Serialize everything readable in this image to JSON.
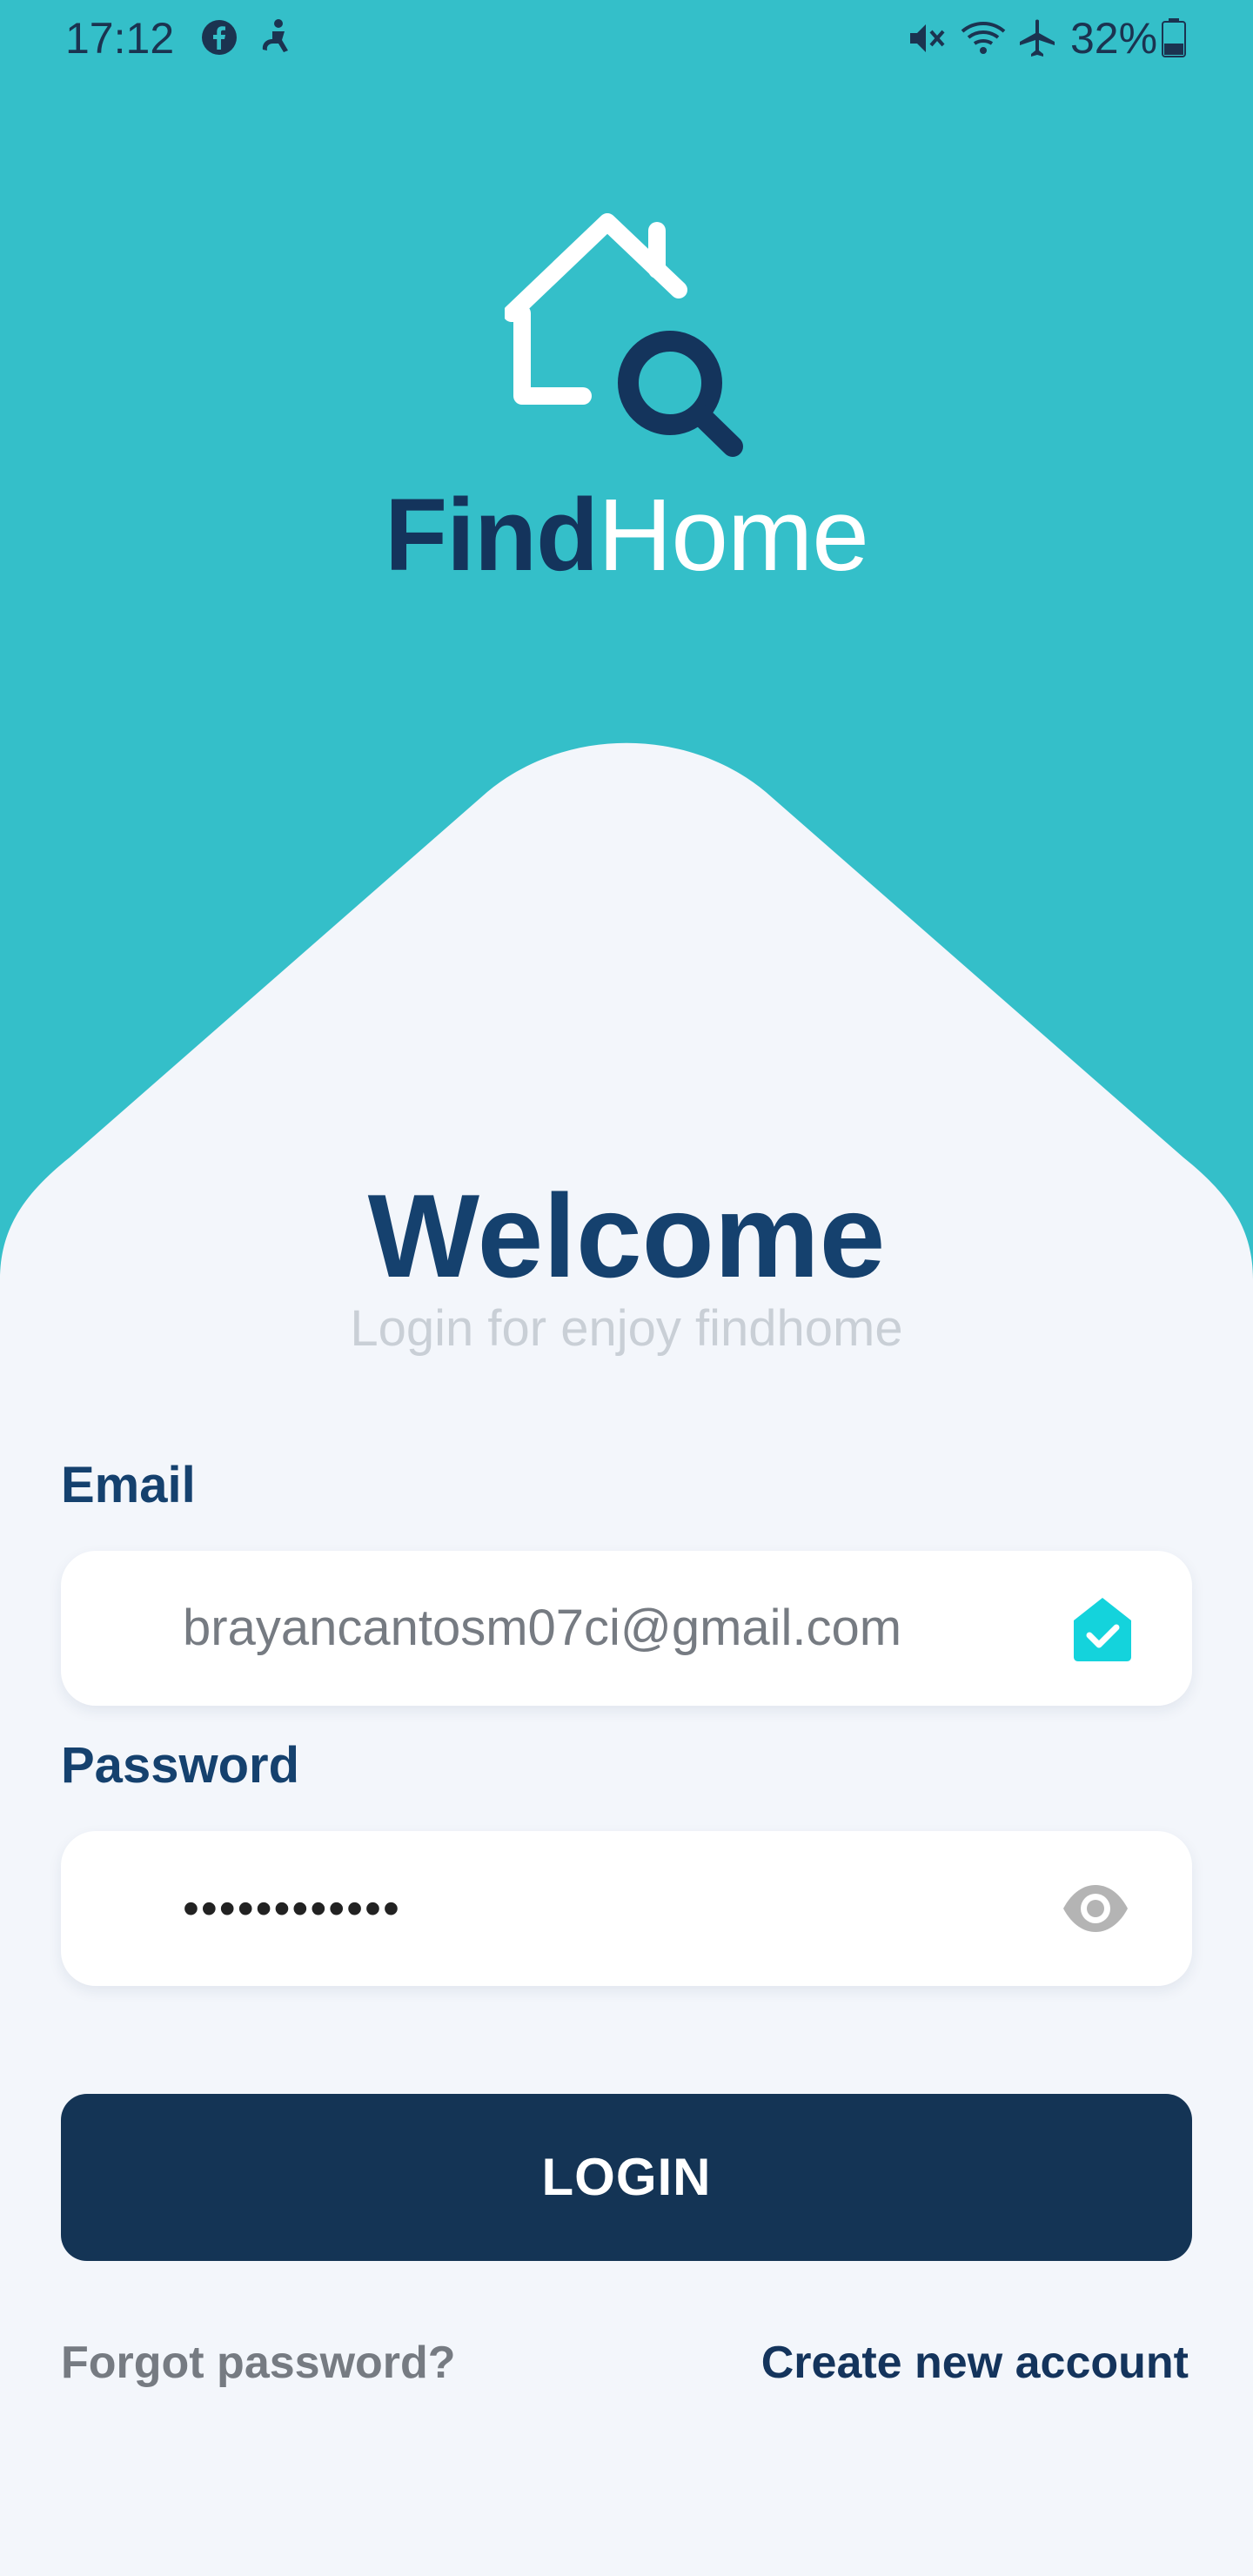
{
  "status_bar": {
    "time": "17:12",
    "battery": "32%",
    "icons": [
      "facebook-icon",
      "accessibility-icon",
      "mute-icon",
      "wifi-icon",
      "airplane-icon",
      "battery-icon"
    ]
  },
  "logo": {
    "find": "Find",
    "home": "Home",
    "icon": "house-search-icon"
  },
  "welcome": {
    "title": "Welcome",
    "subtitle": "Login for enjoy findhome"
  },
  "form": {
    "email_label": "Email",
    "email_value": "brayancantosm07ci@gmail.com",
    "email_status_icon": "verified-house-icon",
    "password_label": "Password",
    "password_value": "••••••••••••",
    "password_toggle_icon": "eye-icon",
    "login_label": "LOGIN",
    "forgot_label": "Forgot password?",
    "create_label": "Create new account"
  },
  "colors": {
    "teal": "#34bfc9",
    "navy": "#143455",
    "title_blue": "#15416e",
    "panel": "#f3f6fb",
    "check_cyan": "#14d3dc"
  }
}
